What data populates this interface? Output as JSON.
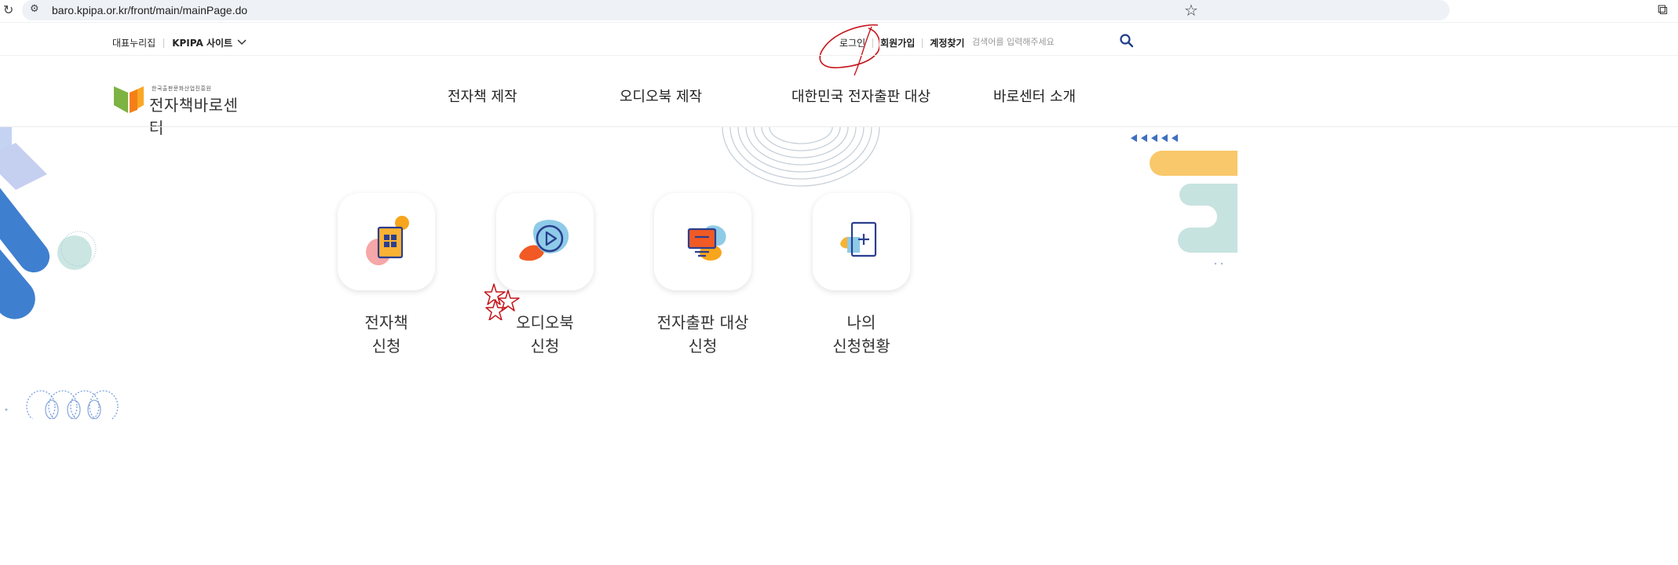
{
  "browser": {
    "url": "baro.kpipa.or.kr/front/main/mainPage.do"
  },
  "utility": {
    "left_links": [
      "대표누리집",
      "KPIPA 사이트"
    ],
    "right_links": [
      "로그인",
      "회원가입",
      "계정찾기"
    ],
    "search_placeholder": "검색어를 입력해주세요"
  },
  "logo": {
    "small": "한국출판문화산업진흥원",
    "big": "전자책바로센터"
  },
  "nav": [
    "전자책 제작",
    "오디오북 제작",
    "대한민국 전자출판 대상",
    "바로센터 소개"
  ],
  "services": [
    {
      "line1": "전자책",
      "line2": "신청",
      "icon": "ebook-icon"
    },
    {
      "line1": "오디오북",
      "line2": "신청",
      "icon": "audiobook-play-icon"
    },
    {
      "line1": "전자출판 대상",
      "line2": "신청",
      "icon": "monitor-icon"
    },
    {
      "line1": "나의",
      "line2": "신청현황",
      "icon": "document-plus-icon"
    }
  ],
  "colors": {
    "brand_blue": "#3a5dbb",
    "orange": "#f07a22",
    "annotation_red": "#c4161c",
    "deco_blue": "#3f7fcf",
    "deco_yellow": "#f9c86a",
    "deco_mint": "#c7e3e0"
  }
}
